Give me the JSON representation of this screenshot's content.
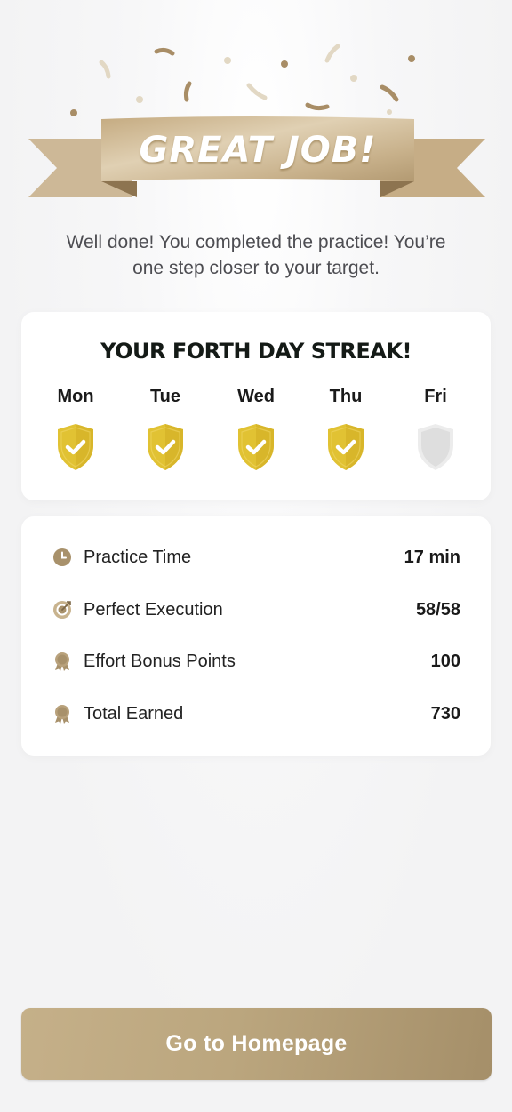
{
  "header": {
    "ribbon_title": "GREAT JOB!",
    "subtitle_line1": "Well done! You completed the practice! You’re",
    "subtitle_line2": "one step closer to your target."
  },
  "streak": {
    "title": "YOUR FORTH DAY STREAK!",
    "days": [
      {
        "label": "Mon",
        "completed": true
      },
      {
        "label": "Tue",
        "completed": true
      },
      {
        "label": "Wed",
        "completed": true
      },
      {
        "label": "Thu",
        "completed": true
      },
      {
        "label": "Fri",
        "completed": false
      }
    ]
  },
  "stats": [
    {
      "icon": "clock-icon",
      "label": "Practice Time",
      "value": "17 min"
    },
    {
      "icon": "target-icon",
      "label": "Perfect Execution",
      "value": "58/58"
    },
    {
      "icon": "medal-icon",
      "label": "Effort Bonus Points",
      "value": "100"
    },
    {
      "icon": "medal-icon",
      "label": "Total Earned",
      "value": "730"
    }
  ],
  "cta": {
    "label": "Go to Homepage"
  },
  "colors": {
    "gold": "#bba67e",
    "shield_active": "#e0c132",
    "shield_inactive": "#e3e3e3"
  }
}
